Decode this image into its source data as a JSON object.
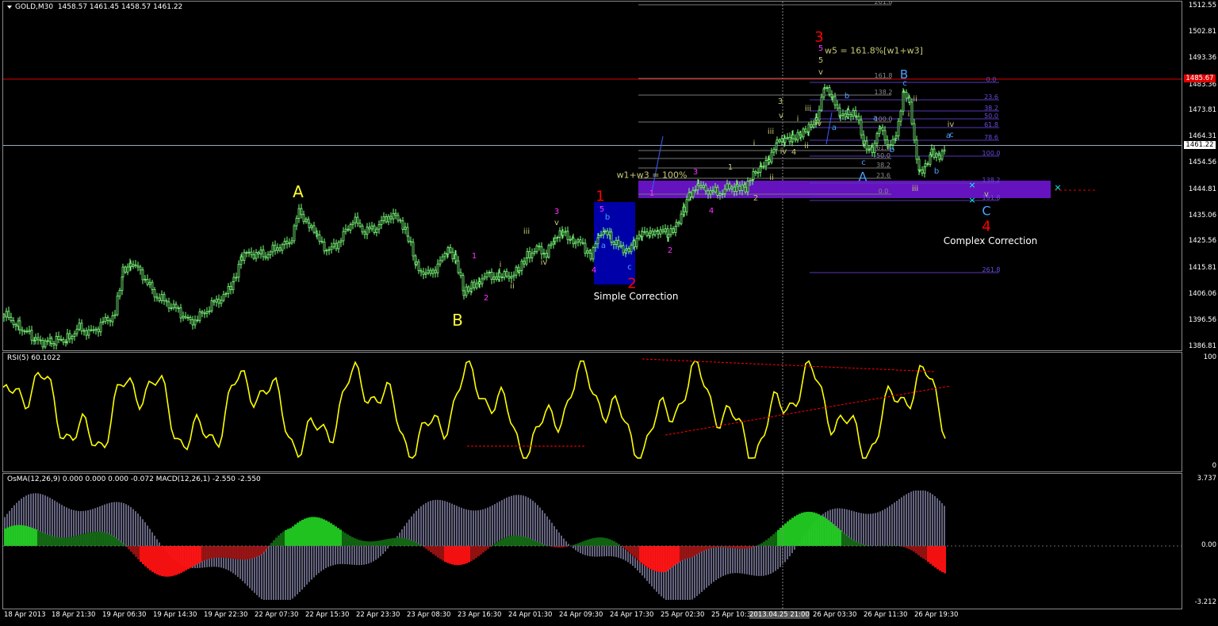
{
  "main": {
    "symbol": "GOLD,M30",
    "ohlc": "1458.57 1461.45 1458.57 1461.22",
    "price_ticks": [
      "1512.55",
      "1502.81",
      "1493.36",
      "1483.36",
      "1473.81",
      "1464.31",
      "1454.56",
      "1444.81",
      "1435.06",
      "1425.56",
      "1415.81",
      "1406.06",
      "1396.56",
      "1386.81"
    ],
    "current_price": "1461.22",
    "red_level_price": "1485.67",
    "annotations": {
      "A_major": "A",
      "B_major": "B",
      "w1_red": "1",
      "w2_red": "2",
      "w3_red": "3",
      "w4_red": "4",
      "simple_correction": "Simple Correction",
      "complex_correction": "Complex Correction",
      "w5_note": "w5 = 161.8%[w1+w3]",
      "w1w3_note": "w1+w3 = 100%",
      "A_blue": "A",
      "B_blue": "B",
      "C_blue": "C"
    },
    "fib_left": [
      "261.8",
      "161.8",
      "138.2",
      "100.0",
      "61.8",
      "50.0",
      "38.2",
      "23.6",
      "0.0"
    ],
    "fib_right": [
      "0.0",
      "23.6",
      "38.2",
      "50.0",
      "61.8",
      "78.6",
      "100.0",
      "138.2",
      "161.8",
      "261.8"
    ]
  },
  "rsi": {
    "title": "RSI(5) 60.1022",
    "ticks": [
      "100",
      "0"
    ]
  },
  "osma": {
    "title": "OsMA(12,26,9) 0.000 0.000 0.000 -0.072  MACD(12,26,1) -2.550 -2.550",
    "ticks": [
      "3.737",
      "0.00",
      "-3.212"
    ]
  },
  "time_axis": [
    "18 Apr 2013",
    "18 Apr 21:30",
    "19 Apr 06:30",
    "19 Apr 14:30",
    "19 Apr 22:30",
    "22 Apr 07:30",
    "22 Apr 15:30",
    "22 Apr 23:30",
    "23 Apr 08:30",
    "23 Apr 16:30",
    "24 Apr 01:30",
    "24 Apr 09:30",
    "24 Apr 17:30",
    "25 Apr 02:30",
    "25 Apr 10:30",
    "2013.04.25 21:00",
    "26 Apr 03:30",
    "26 Apr 11:30",
    "26 Apr 19:30"
  ],
  "colors": {
    "bull": "#7cff7c",
    "rsi": "#ffff00",
    "red": "#ff0000",
    "magenta": "#ff33ff",
    "olive": "#c8c878",
    "blue": "#4aa0ff",
    "purple": "#6a14c8"
  }
}
